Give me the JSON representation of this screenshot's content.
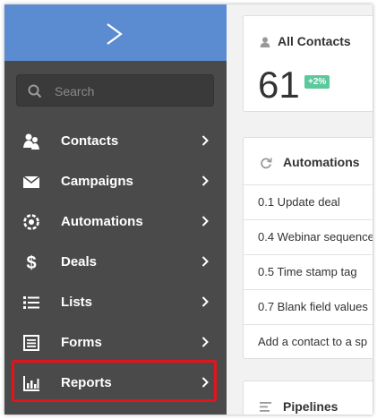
{
  "search": {
    "placeholder": "Search"
  },
  "nav": [
    {
      "label": "Contacts",
      "icon": "contacts-icon"
    },
    {
      "label": "Campaigns",
      "icon": "envelope-icon"
    },
    {
      "label": "Automations",
      "icon": "automations-gear-icon"
    },
    {
      "label": "Deals",
      "icon": "dollar-icon"
    },
    {
      "label": "Lists",
      "icon": "list-icon"
    },
    {
      "label": "Forms",
      "icon": "form-icon"
    },
    {
      "label": "Reports",
      "icon": "bar-chart-icon",
      "highlighted": true
    }
  ],
  "contacts_card": {
    "title": "All Contacts",
    "count": "61",
    "change": "+2%"
  },
  "automations_card": {
    "title": "Automations",
    "items": [
      "0.1 Update deal",
      "0.4 Webinar sequence",
      "0.5 Time stamp tag",
      "0.7 Blank field values",
      "Add a contact to a sp"
    ]
  },
  "pipelines_card": {
    "title": "Pipelines"
  },
  "colors": {
    "sidebar": "#4a4a4a",
    "logo_bar": "#5b8bd0",
    "highlight_border": "#e3141b",
    "badge": "#5cc99c"
  }
}
